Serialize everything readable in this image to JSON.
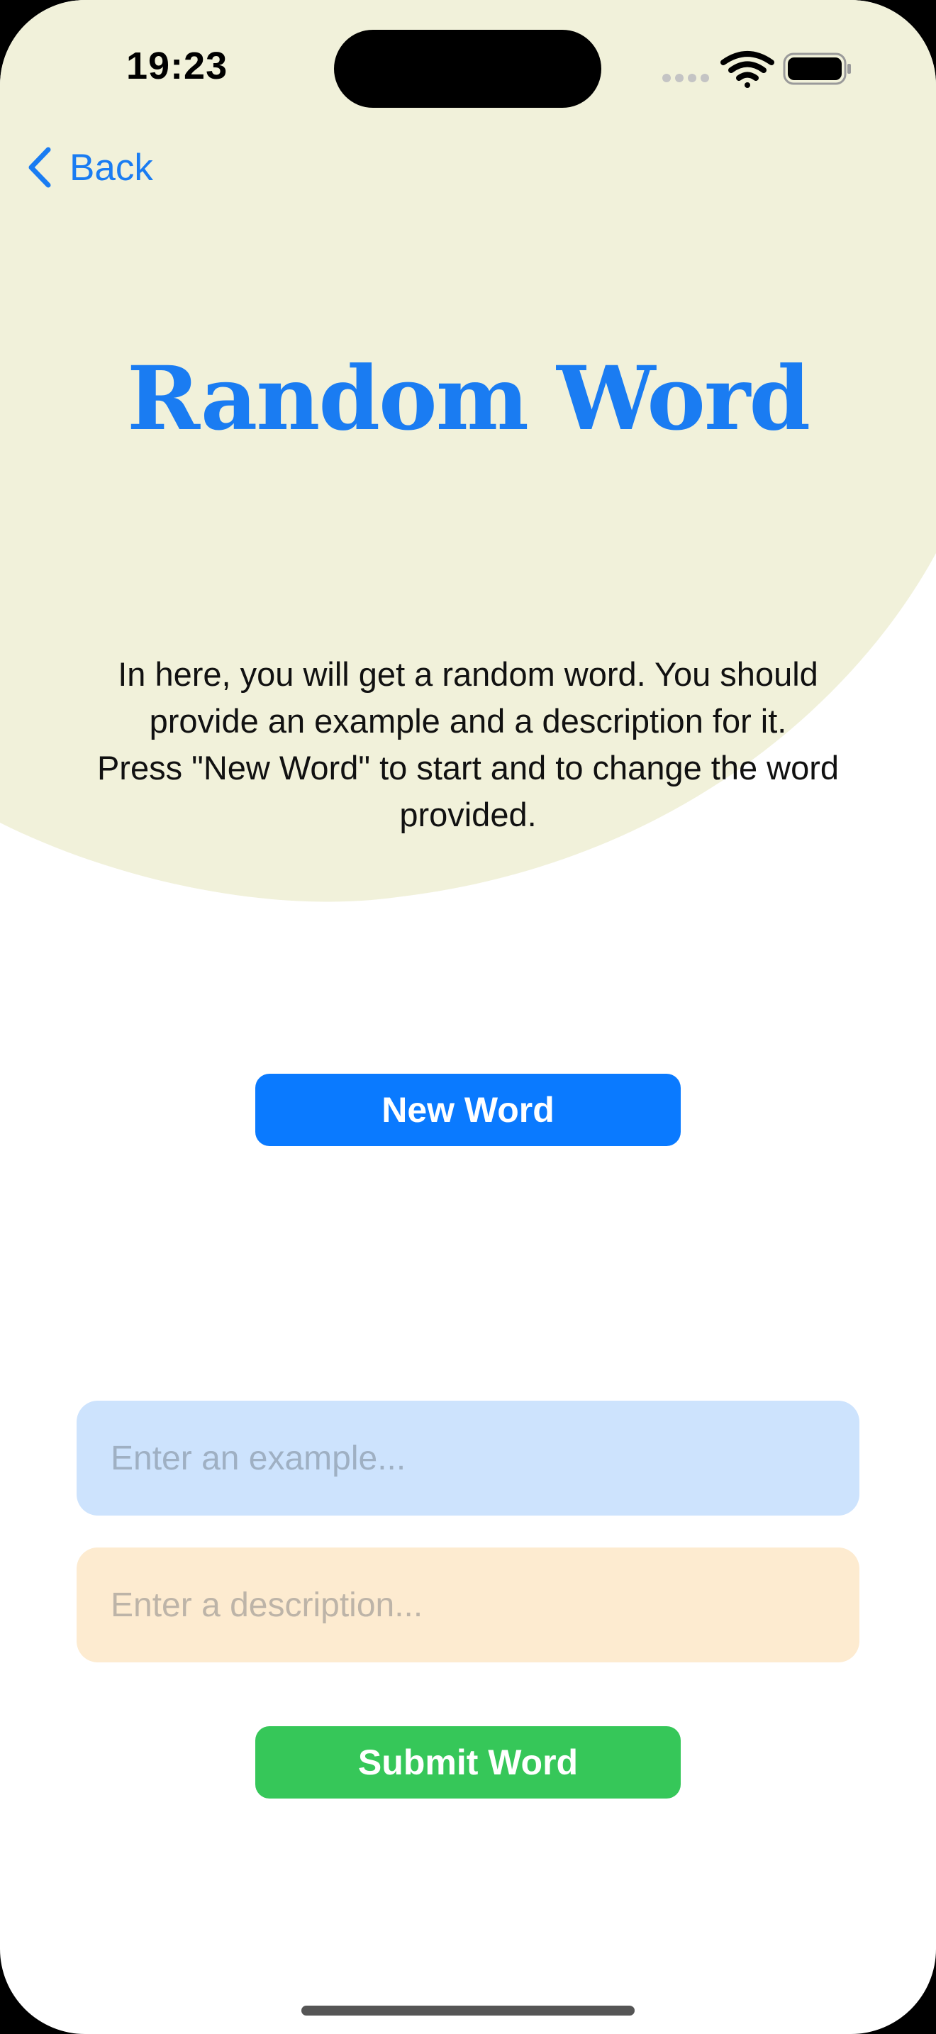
{
  "status_bar": {
    "time": "19:23",
    "icons": [
      "signal-icon",
      "wifi-icon",
      "battery-icon"
    ]
  },
  "nav": {
    "back_label": "Back",
    "back_icon": "chevron-left-icon"
  },
  "page": {
    "title": "Random Word",
    "description_lines": [
      "In here, you will get a random word. You should provide an example and a description for it.",
      "Press \"New Word\" to start and to change the word provided."
    ]
  },
  "actions": {
    "new_word_label": "New Word",
    "submit_label": "Submit Word"
  },
  "form": {
    "example": {
      "value": "",
      "placeholder": "Enter an example..."
    },
    "description": {
      "value": "",
      "placeholder": "Enter a description..."
    }
  },
  "colors": {
    "accent": "#0a7aff",
    "submit": "#36c759",
    "backdrop_blob": "#f1f1da",
    "example_field": "#cde3fd",
    "description_field": "#fdebd0"
  }
}
